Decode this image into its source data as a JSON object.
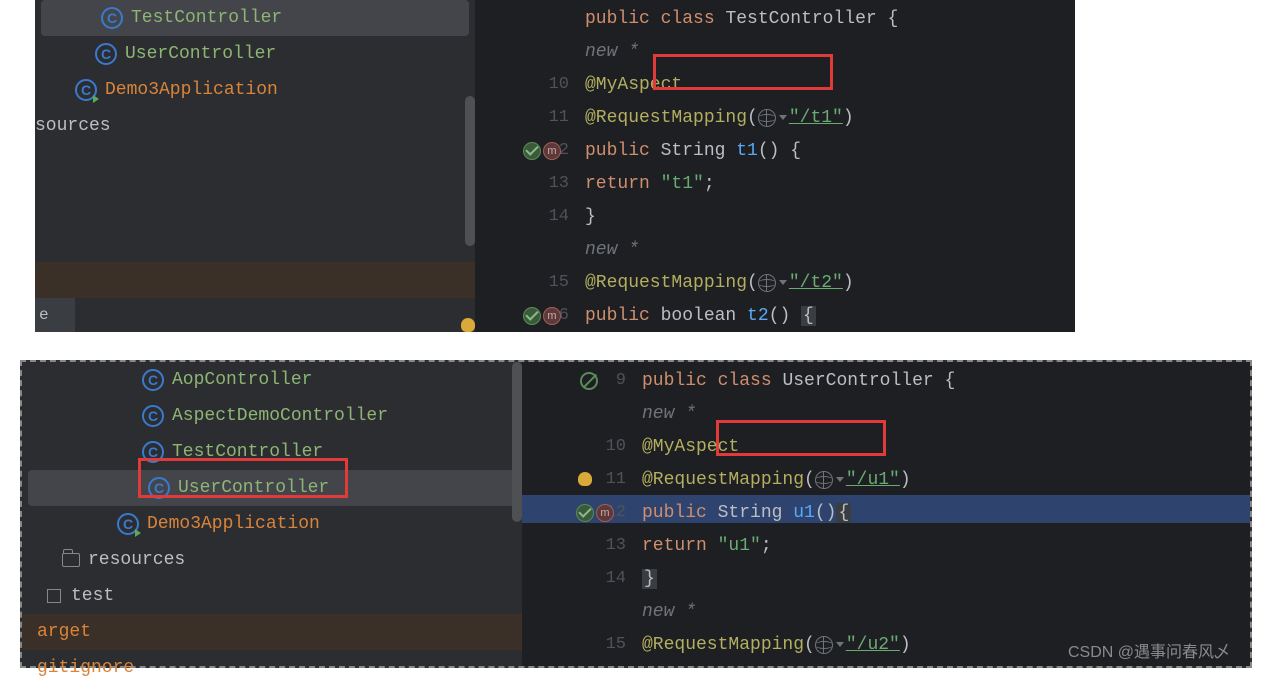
{
  "panel1": {
    "tree": [
      {
        "icon": "class",
        "label": "TestController",
        "selected": true,
        "pad": "pad1",
        "cls": "green-label"
      },
      {
        "icon": "class",
        "label": "UserController",
        "pad": "pad1",
        "cls": "green-label"
      },
      {
        "icon": "class-run",
        "label": "Demo3Application",
        "pad": "pad2",
        "cls": "orange"
      },
      {
        "icon": "",
        "label": "sources",
        "pad": "",
        "cls": "gray-label",
        "no_icon": true
      }
    ],
    "code": {
      "class_decl": {
        "kw1": "public",
        "kw2": "class",
        "name": "TestController",
        "brace": " {"
      },
      "lines": [
        {
          "n": "",
          "hint": "new *"
        },
        {
          "n": "10",
          "ann": "@MyAspect"
        },
        {
          "n": "11",
          "ann": "@RequestMapping",
          "paren": "(",
          "url": "\"/t1\"",
          "close": ")"
        },
        {
          "n": "12",
          "icons": "gr",
          "kw": "public",
          "type": " String ",
          "fn": "t1",
          "rest": "() {"
        },
        {
          "n": "13",
          "kw": "return",
          "str": " \"t1\"",
          "semi": ";"
        },
        {
          "n": "14",
          "brace": "}"
        },
        {
          "n": "",
          "hint": "new *"
        },
        {
          "n": "15",
          "ann": "@RequestMapping",
          "paren": "(",
          "url": "\"/t2\"",
          "close": ")"
        },
        {
          "n": "16",
          "icons": "gr",
          "kw": "public",
          "type": " boolean ",
          "fn": "t2",
          "rest": "() ",
          "caret": "{"
        }
      ]
    }
  },
  "panel2": {
    "tree": [
      {
        "icon": "class",
        "label": "AopController",
        "pad": "pad3",
        "cls": "green-label"
      },
      {
        "icon": "class",
        "label": "AspectDemoController",
        "pad": "pad3",
        "cls": "green-label"
      },
      {
        "icon": "class",
        "label": "TestController",
        "pad": "pad3",
        "cls": "green-label"
      },
      {
        "icon": "class",
        "label": "UserController",
        "selected": true,
        "pad": "pad3",
        "cls": "green-label"
      },
      {
        "icon": "class-run",
        "label": "Demo3Application",
        "pad": "pad4",
        "cls": "orange"
      },
      {
        "icon": "folder",
        "label": "resources",
        "pad": "pad5",
        "cls": "gray-label",
        "chev": true
      },
      {
        "icon": "square",
        "label": "test",
        "pad": "pad6",
        "cls": "gray-label",
        "chev": true
      },
      {
        "icon": "",
        "label": "arget",
        "pad": "pad7",
        "cls": "orange",
        "no_icon": true
      },
      {
        "icon": "",
        "label": "gitignore",
        "pad": "pad7",
        "cls": "orange",
        "no_icon": true
      }
    ],
    "code": {
      "lines": [
        {
          "n": "9",
          "icons": "slash",
          "kw1": "public",
          "kw2": "class",
          "name": "UserController",
          "brace": " {"
        },
        {
          "n": "",
          "hint": "new *"
        },
        {
          "n": "10",
          "ann": "@MyAspect"
        },
        {
          "n": "11",
          "bulb": true,
          "ann": "@RequestMapping",
          "paren": "(",
          "url": "\"/u1\"",
          "close": ")"
        },
        {
          "n": "12",
          "icons": "gr",
          "kw": "public",
          "type": " String ",
          "fn": "u1",
          "rest": "()",
          "caret": "{"
        },
        {
          "n": "13",
          "kw": "return",
          "str": " \"u1\"",
          "semi": ";"
        },
        {
          "n": "14",
          "caret_brace": "}"
        },
        {
          "n": "",
          "hint": "new *"
        },
        {
          "n": "15",
          "ann": "@RequestMapping",
          "paren": "(",
          "url": "\"/u2\"",
          "close": ")"
        }
      ]
    }
  },
  "watermark": "CSDN @遇事问春风乄"
}
